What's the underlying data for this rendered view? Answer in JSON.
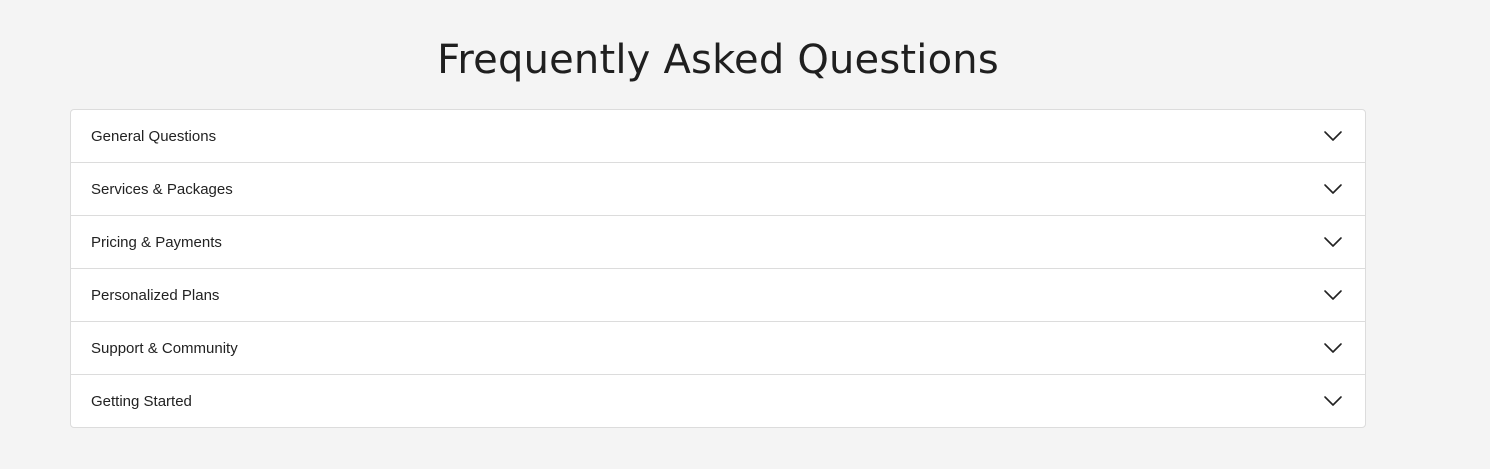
{
  "page": {
    "title": "Frequently Asked Questions"
  },
  "faq": {
    "items": [
      {
        "label": "General Questions",
        "icon": "chevron-down-icon"
      },
      {
        "label": "Services & Packages",
        "icon": "chevron-down-icon"
      },
      {
        "label": "Pricing & Payments",
        "icon": "chevron-down-icon"
      },
      {
        "label": "Personalized Plans",
        "icon": "chevron-down-icon"
      },
      {
        "label": "Support & Community",
        "icon": "chevron-down-icon"
      },
      {
        "label": "Getting Started",
        "icon": "chevron-down-icon"
      }
    ]
  },
  "colors": {
    "background": "#f4f4f4",
    "panel": "#ffffff",
    "border": "#dcdcdc",
    "text": "#222222"
  }
}
